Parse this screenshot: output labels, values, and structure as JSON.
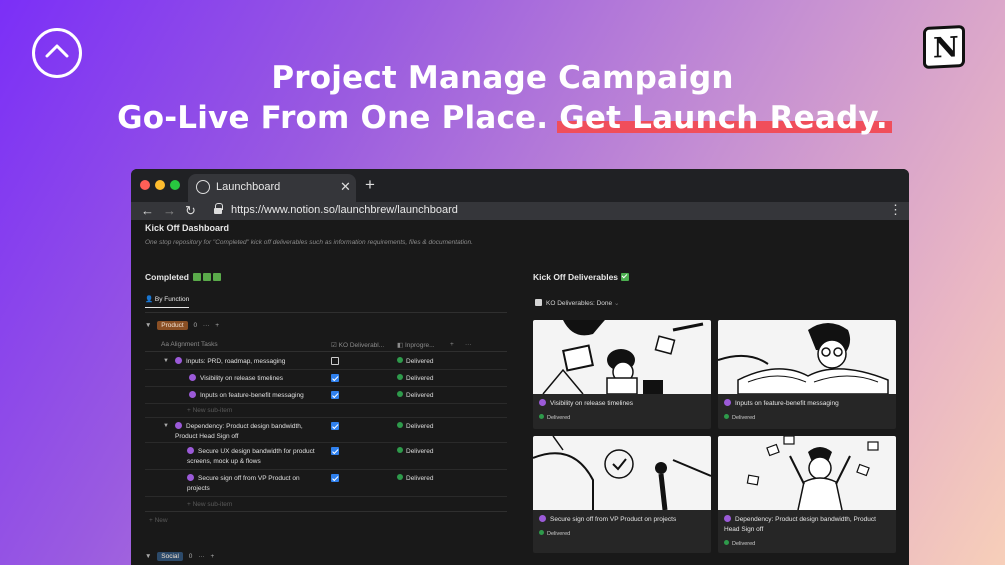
{
  "header": {
    "line1": "Project Manage Campaign",
    "line2_plain": "Go-Live From One Place.",
    "line2_highlight": "Get Launch Ready."
  },
  "browser": {
    "tab_title": "Launchboard",
    "tab_close": "✕",
    "new_tab": "+",
    "url": "https://www.notion.so/launchbrew/launchboard"
  },
  "page": {
    "title": "Kick Off Dashboard",
    "description": "One stop repository for \"Completed\" kick off deliverables such as information requirements, files & documentation."
  },
  "completed": {
    "title": "Completed",
    "view_tab": "By Function",
    "groups": [
      {
        "tag": "Product",
        "count": "0",
        "menu": "···",
        "add": "+"
      },
      {
        "tag": "Social",
        "count": "0",
        "menu": "···",
        "add": "+"
      }
    ],
    "columns": {
      "name": "Aa  Alignment Tasks",
      "ko": "KO Deliverabl...",
      "progress": "Inprogre...",
      "add": "+",
      "more": "···"
    },
    "rows": [
      {
        "name": "Inputs: PRD, roadmap, messaging",
        "checked": false,
        "status": "Delivered"
      },
      {
        "name": "Visibility on release timelines",
        "checked": true,
        "status": "Delivered"
      },
      {
        "name": "Inputs on feature-benefit messaging",
        "checked": true,
        "status": "Delivered"
      },
      {
        "name": "Dependency: Product design bandwidth, Product Head Sign off",
        "checked": true,
        "status": "Delivered"
      },
      {
        "name": "Secure UX design bandwidth for product screens, mock up & flows",
        "checked": true,
        "status": "Delivered"
      },
      {
        "name": "Secure sign off from VP Product on projects",
        "checked": true,
        "status": "Delivered"
      }
    ],
    "new_sub_item": "+  New sub-item",
    "new": "+  New"
  },
  "deliverables": {
    "title": "Kick Off Deliverables",
    "filter": "KO Deliverables: Done",
    "cards": [
      {
        "title": "Visibility on release timelines",
        "status": "Delivered"
      },
      {
        "title": "Inputs on feature-benefit messaging",
        "status": "Delivered"
      },
      {
        "title": "Secure sign off from VP Product on projects",
        "status": "Delivered"
      },
      {
        "title": "Dependency: Product design bandwidth, Product Head Sign off",
        "status": "Delivered"
      }
    ]
  }
}
